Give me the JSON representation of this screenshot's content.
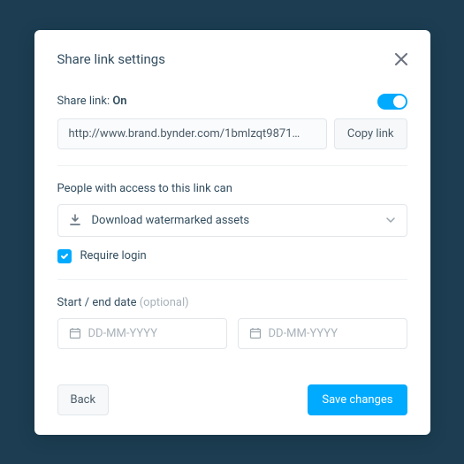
{
  "header": {
    "title": "Share link settings"
  },
  "shareLink": {
    "label_prefix": "Share link: ",
    "status": "On",
    "url": "http://www.brand.bynder.com/1bmlzqt9871…",
    "copy_label": "Copy link"
  },
  "access": {
    "label": "People with access to this link can",
    "selected": "Download watermarked assets",
    "require_login_label": "Require login",
    "require_login_checked": true
  },
  "dates": {
    "label": "Start / end date ",
    "optional": "(optional)",
    "start_placeholder": "DD-MM-YYYY",
    "end_placeholder": "DD-MM-YYYY"
  },
  "footer": {
    "back_label": "Back",
    "save_label": "Save changes"
  },
  "colors": {
    "accent": "#00aaff"
  }
}
